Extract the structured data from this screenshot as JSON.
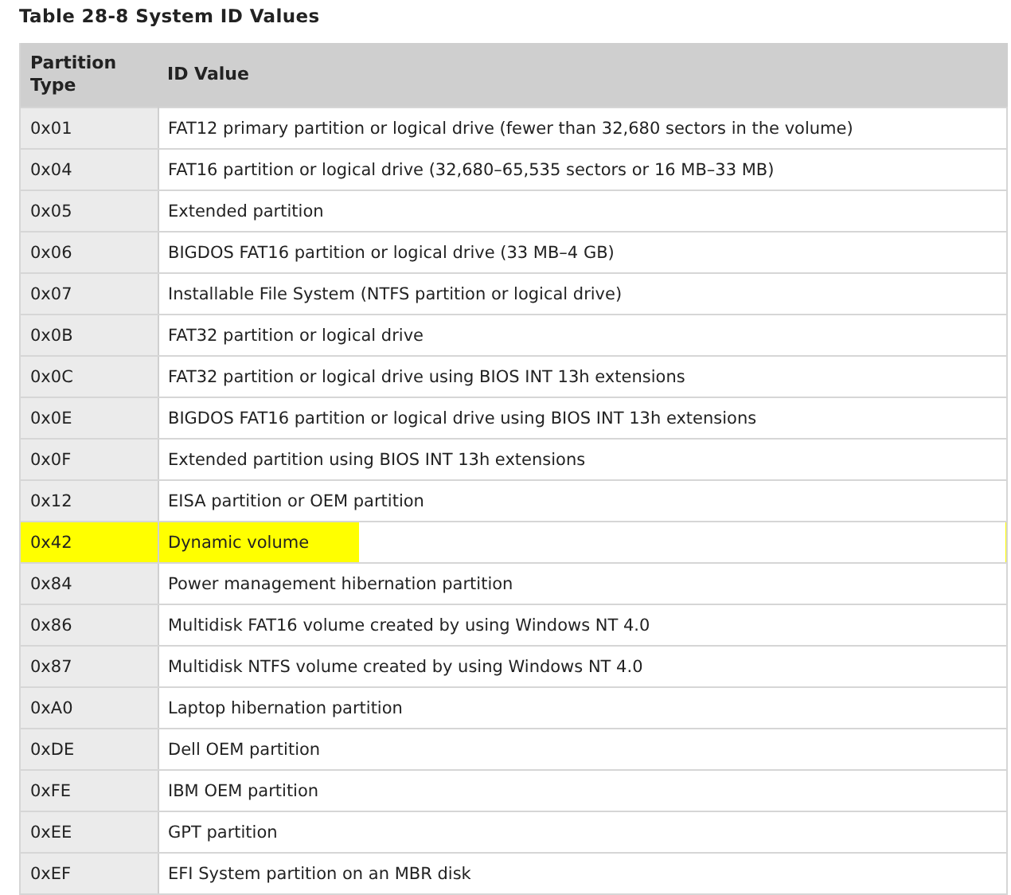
{
  "title": "Table 28-8 System ID Values",
  "table": {
    "columns": [
      "Partition Type",
      "ID Value"
    ],
    "rows": [
      {
        "type": "0x01",
        "value": "FAT12 primary partition or logical drive (fewer than 32,680 sectors in the volume)",
        "highlighted": false
      },
      {
        "type": "0x04",
        "value": "FAT16 partition or logical drive (32,680–65,535 sectors or 16 MB–33 MB)",
        "highlighted": false
      },
      {
        "type": "0x05",
        "value": "Extended partition",
        "highlighted": false
      },
      {
        "type": "0x06",
        "value": "BIGDOS FAT16 partition or logical drive (33 MB–4 GB)",
        "highlighted": false
      },
      {
        "type": "0x07",
        "value": "Installable File System (NTFS partition or logical drive)",
        "highlighted": false
      },
      {
        "type": "0x0B",
        "value": "FAT32 partition or logical drive",
        "highlighted": false
      },
      {
        "type": "0x0C",
        "value": "FAT32 partition or logical drive using BIOS INT 13h extensions",
        "highlighted": false
      },
      {
        "type": "0x0E",
        "value": "BIGDOS FAT16 partition or logical drive using BIOS INT 13h extensions",
        "highlighted": false
      },
      {
        "type": "0x0F",
        "value": "Extended partition using BIOS INT 13h extensions",
        "highlighted": false
      },
      {
        "type": "0x12",
        "value": "EISA partition or OEM partition",
        "highlighted": false
      },
      {
        "type": "0x42",
        "value": "Dynamic volume",
        "highlighted": true
      },
      {
        "type": "0x84",
        "value": "Power management hibernation partition",
        "highlighted": false
      },
      {
        "type": "0x86",
        "value": "Multidisk FAT16 volume created by using Windows NT 4.0",
        "highlighted": false
      },
      {
        "type": "0x87",
        "value": "Multidisk NTFS volume created by using Windows NT 4.0",
        "highlighted": false
      },
      {
        "type": "0xA0",
        "value": "Laptop hibernation partition",
        "highlighted": false
      },
      {
        "type": "0xDE",
        "value": "Dell OEM partition",
        "highlighted": false
      },
      {
        "type": "0xFE",
        "value": "IBM OEM partition",
        "highlighted": false
      },
      {
        "type": "0xEE",
        "value": "GPT partition",
        "highlighted": false
      },
      {
        "type": "0xEF",
        "value": "EFI System partition on an MBR disk",
        "highlighted": false
      }
    ]
  }
}
